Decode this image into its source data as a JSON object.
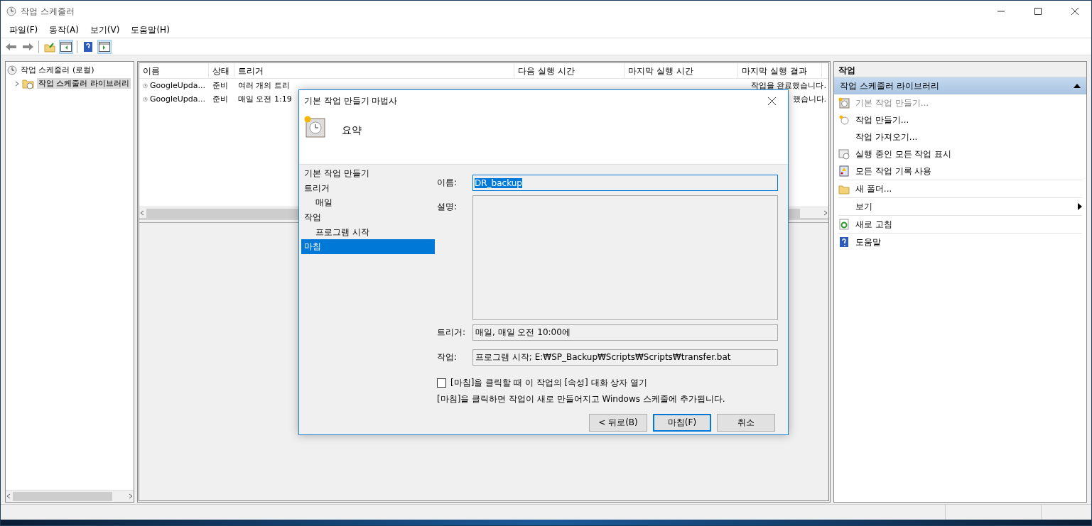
{
  "window": {
    "title": "작업 스케줄러"
  },
  "menu": [
    "파일(F)",
    "동작(A)",
    "보기(V)",
    "도움말(H)"
  ],
  "tree": [
    {
      "label": "작업 스케줄러 (로컬)",
      "selected": false,
      "children": [
        {
          "label": "작업 스케줄러 라이브러리",
          "selected": true,
          "expanded": false
        }
      ]
    }
  ],
  "task_list": {
    "columns": [
      "이름",
      "상태",
      "트리거",
      "다음 실행 시간",
      "마지막 실행 시간",
      "마지막 실행 결과"
    ],
    "rows": [
      {
        "name": "GoogleUpda...",
        "status": "준비",
        "trigger": "여러 개의 트리",
        "last_result": "작업을 완료했습니다."
      },
      {
        "name": "GoogleUpda...",
        "status": "준비",
        "trigger": "매일 오전 1:19",
        "last_result": "했습니다."
      }
    ]
  },
  "actions": {
    "title": "작업",
    "section": {
      "title": "작업 스케줄러 라이브러리",
      "expanded": true
    },
    "groups": [
      [
        {
          "label": "기본 작업 만들기...",
          "disabled": true
        },
        {
          "label": "작업 만들기...",
          "disabled": false
        },
        {
          "label": "작업 가져오기...",
          "disabled": false
        },
        {
          "label": "실행 중인 모든 작업 표시",
          "disabled": false
        },
        {
          "label": "모든 작업 기록 사용",
          "disabled": false
        }
      ],
      [
        {
          "label": "새 폴더...",
          "disabled": false
        }
      ],
      [
        {
          "label": "보기",
          "disabled": false,
          "submenu": true
        }
      ],
      [
        {
          "label": "새로 고침",
          "disabled": false
        }
      ],
      [
        {
          "label": "도움말",
          "disabled": false
        }
      ]
    ]
  },
  "dialog": {
    "title": "기본 작업 만들기 마법사",
    "heading": "요약",
    "steps": [
      {
        "label": "기본 작업 만들기",
        "selected": false
      },
      {
        "label": "트리거",
        "selected": false,
        "children": [
          {
            "label": "매일",
            "selected": false
          }
        ]
      },
      {
        "label": "작업",
        "selected": false,
        "children": [
          {
            "label": "프로그램 시작",
            "selected": false
          }
        ]
      },
      {
        "label": "마침",
        "selected": true
      }
    ],
    "name": {
      "label": "이름:",
      "value": "DR_backup"
    },
    "description": {
      "label": "설명:"
    },
    "trigger": {
      "label": "트리거:",
      "value": "매일, 매일 오전 10:00에"
    },
    "action": {
      "label": "작업:",
      "value": "프로그램 시작; E:₩SP_Backup₩Scripts₩Scripts₩transfer.bat"
    },
    "open_properties": {
      "label": "[마침]을 클릭할 때 이 작업의 [속성] 대화 상자 열기",
      "checked": false
    },
    "note": "[마침]을 클릭하면 작업이 새로 만들어지고 Windows 스케줄에 추가됩니다.",
    "buttons": [
      {
        "label": "< 뒤로(B)",
        "default": false
      },
      {
        "label": "마침(F)",
        "default": true
      },
      {
        "label": "취소",
        "default": false
      }
    ]
  }
}
